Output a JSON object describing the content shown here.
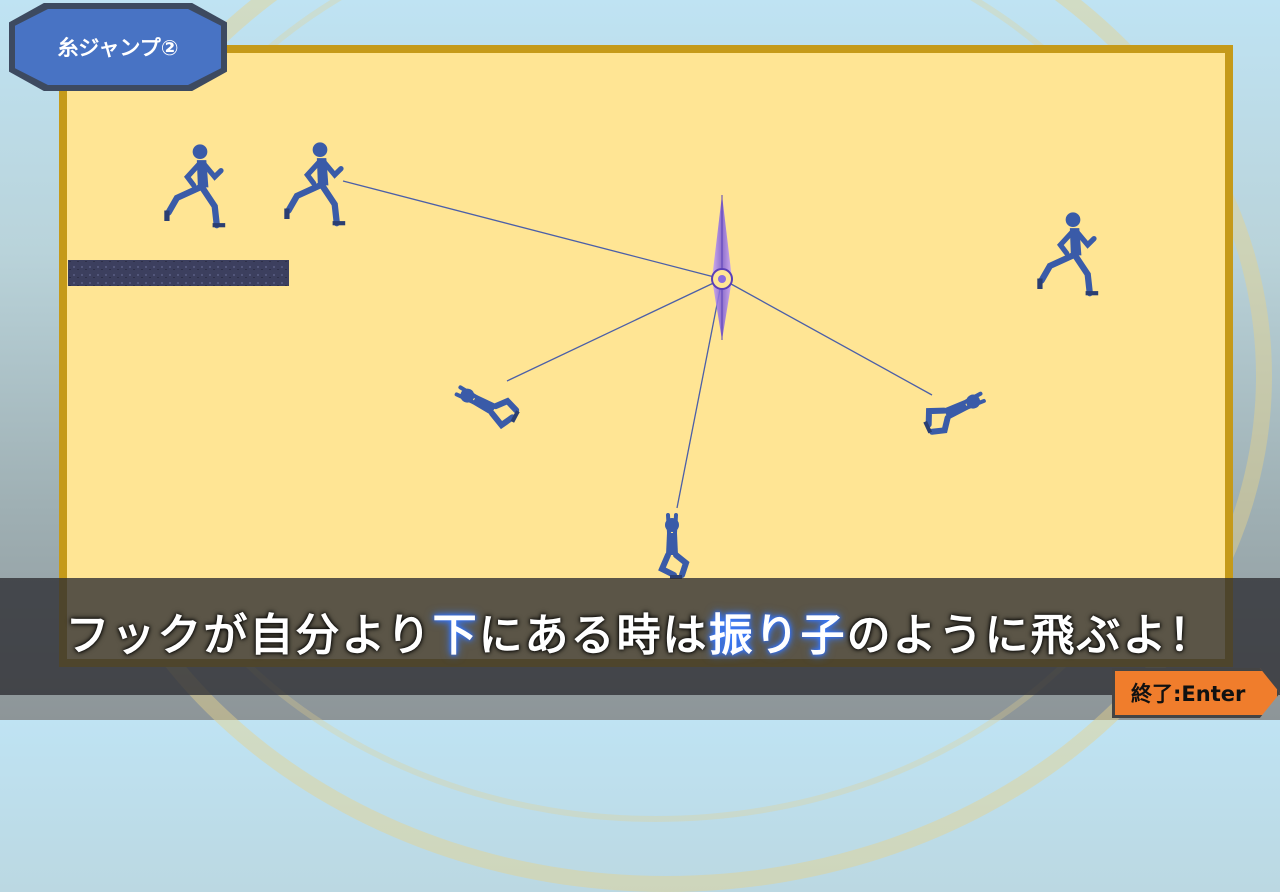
{
  "level_tab": {
    "label": "糸ジャンプ②"
  },
  "caption": {
    "part1": "フックが自分より",
    "part2": "下",
    "part3": "にある時は",
    "part4": "振り子",
    "part5": "のように飛ぶよ！"
  },
  "exit_button": {
    "label": "終了:Enter"
  },
  "colors": {
    "stage_fill": "#ffe594",
    "stage_border": "#c59a1a",
    "tab_fill": "#4873c4",
    "character_suit": "#3a5ba8",
    "rope": "#4b5fa8",
    "exit_fill": "#f07d2c"
  },
  "icons": {
    "hook": "hook-anchor-icon",
    "character": "running-businessman-icon"
  }
}
